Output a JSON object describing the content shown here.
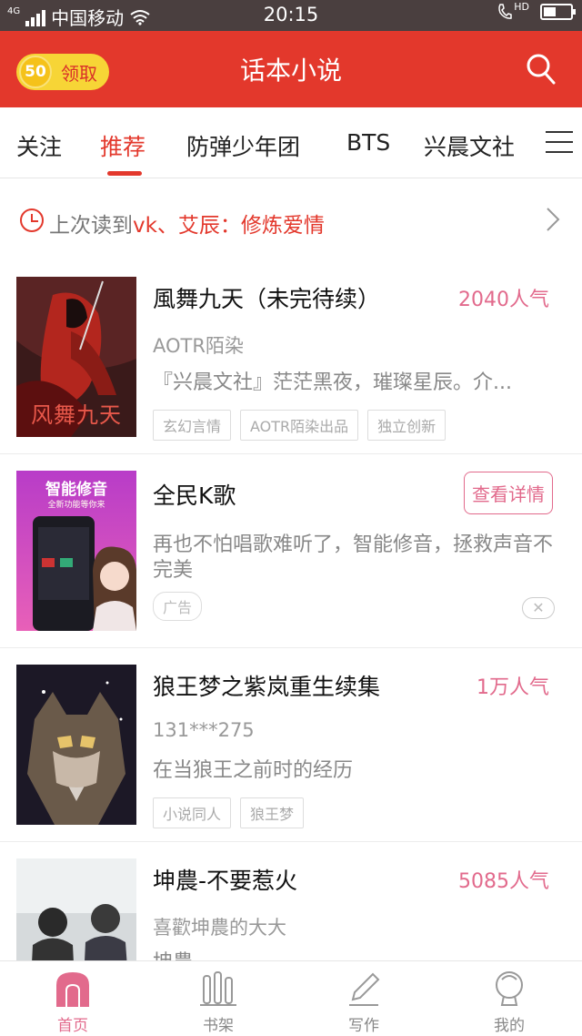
{
  "status_bar": {
    "network": "4G",
    "carrier": "中国移动",
    "time": "20:15",
    "call_label": "HD",
    "battery_level": 0.45
  },
  "header": {
    "coin_amount": "50",
    "claim_label": "领取",
    "title": "话本小说"
  },
  "tabs": [
    "关注",
    "推荐",
    "防弹少年团",
    "BTS",
    "兴晨文社"
  ],
  "active_tab": "推荐",
  "last_read": {
    "prefix": "上次读到",
    "highlight": "vk、艾辰：修炼爱情"
  },
  "cards": [
    {
      "title": "風舞九天（未完待续）",
      "popularity": "2040人气",
      "author": "AOTR陌染",
      "description": "『兴晨文社』茫茫黑夜，璀璨星辰。介...",
      "tags": [
        "玄幻言情",
        "AOTR陌染出品",
        "独立创新"
      ],
      "cover_text": "风舞九天"
    },
    {
      "title": "全民K歌",
      "button": "查看详情",
      "description": "再也不怕唱歌难听了，智能修音，拯救声音不完美",
      "ad_label": "广告",
      "close_label": "✕",
      "cover_title": "智能修音",
      "cover_subtitle": "全新功能等你来"
    },
    {
      "title": "狼王梦之紫岚重生续集",
      "popularity": "1万人气",
      "author": "131***275",
      "description": "在当狼王之前时的经历",
      "tags": [
        "小说同人",
        "狼王梦"
      ]
    },
    {
      "title": "坤農-不要惹火",
      "popularity": "5085人气",
      "author": "喜歡坤農的大大",
      "description": "坤農"
    }
  ],
  "bottom_nav": [
    {
      "label": "首页",
      "icon": "home-icon"
    },
    {
      "label": "书架",
      "icon": "bookshelf-icon"
    },
    {
      "label": "写作",
      "icon": "pencil-icon"
    },
    {
      "label": "我的",
      "icon": "profile-icon"
    }
  ],
  "colors": {
    "brand_red": "#e3382c",
    "popularity_pink": "#e26a8c",
    "status_bar": "#4a3f3f",
    "coin_yellow": "#f7d536"
  }
}
